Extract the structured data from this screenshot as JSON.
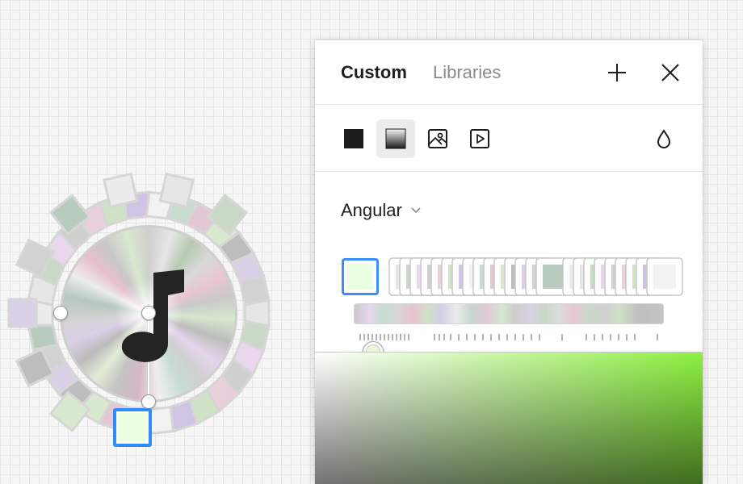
{
  "panel": {
    "tabs": {
      "custom": "Custom",
      "libraries": "Libraries"
    },
    "header_icons": [
      "plus-icon",
      "close-icon"
    ],
    "paint_types": [
      {
        "name": "solid",
        "icon": "solid-square-icon"
      },
      {
        "name": "gradient",
        "icon": "gradient-square-icon",
        "selected": true
      },
      {
        "name": "image",
        "icon": "image-icon"
      },
      {
        "name": "video",
        "icon": "video-icon"
      },
      {
        "name": "opacity",
        "icon": "drop-icon"
      }
    ],
    "gradient_type": "Angular",
    "selected_stop_color": "#eaffdf",
    "picker_hue": "#8cf040",
    "accent_color": "#3a8dff"
  },
  "canvas": {
    "note_icon": "music-note-icon",
    "selected_stop_color": "#eaffdf"
  }
}
